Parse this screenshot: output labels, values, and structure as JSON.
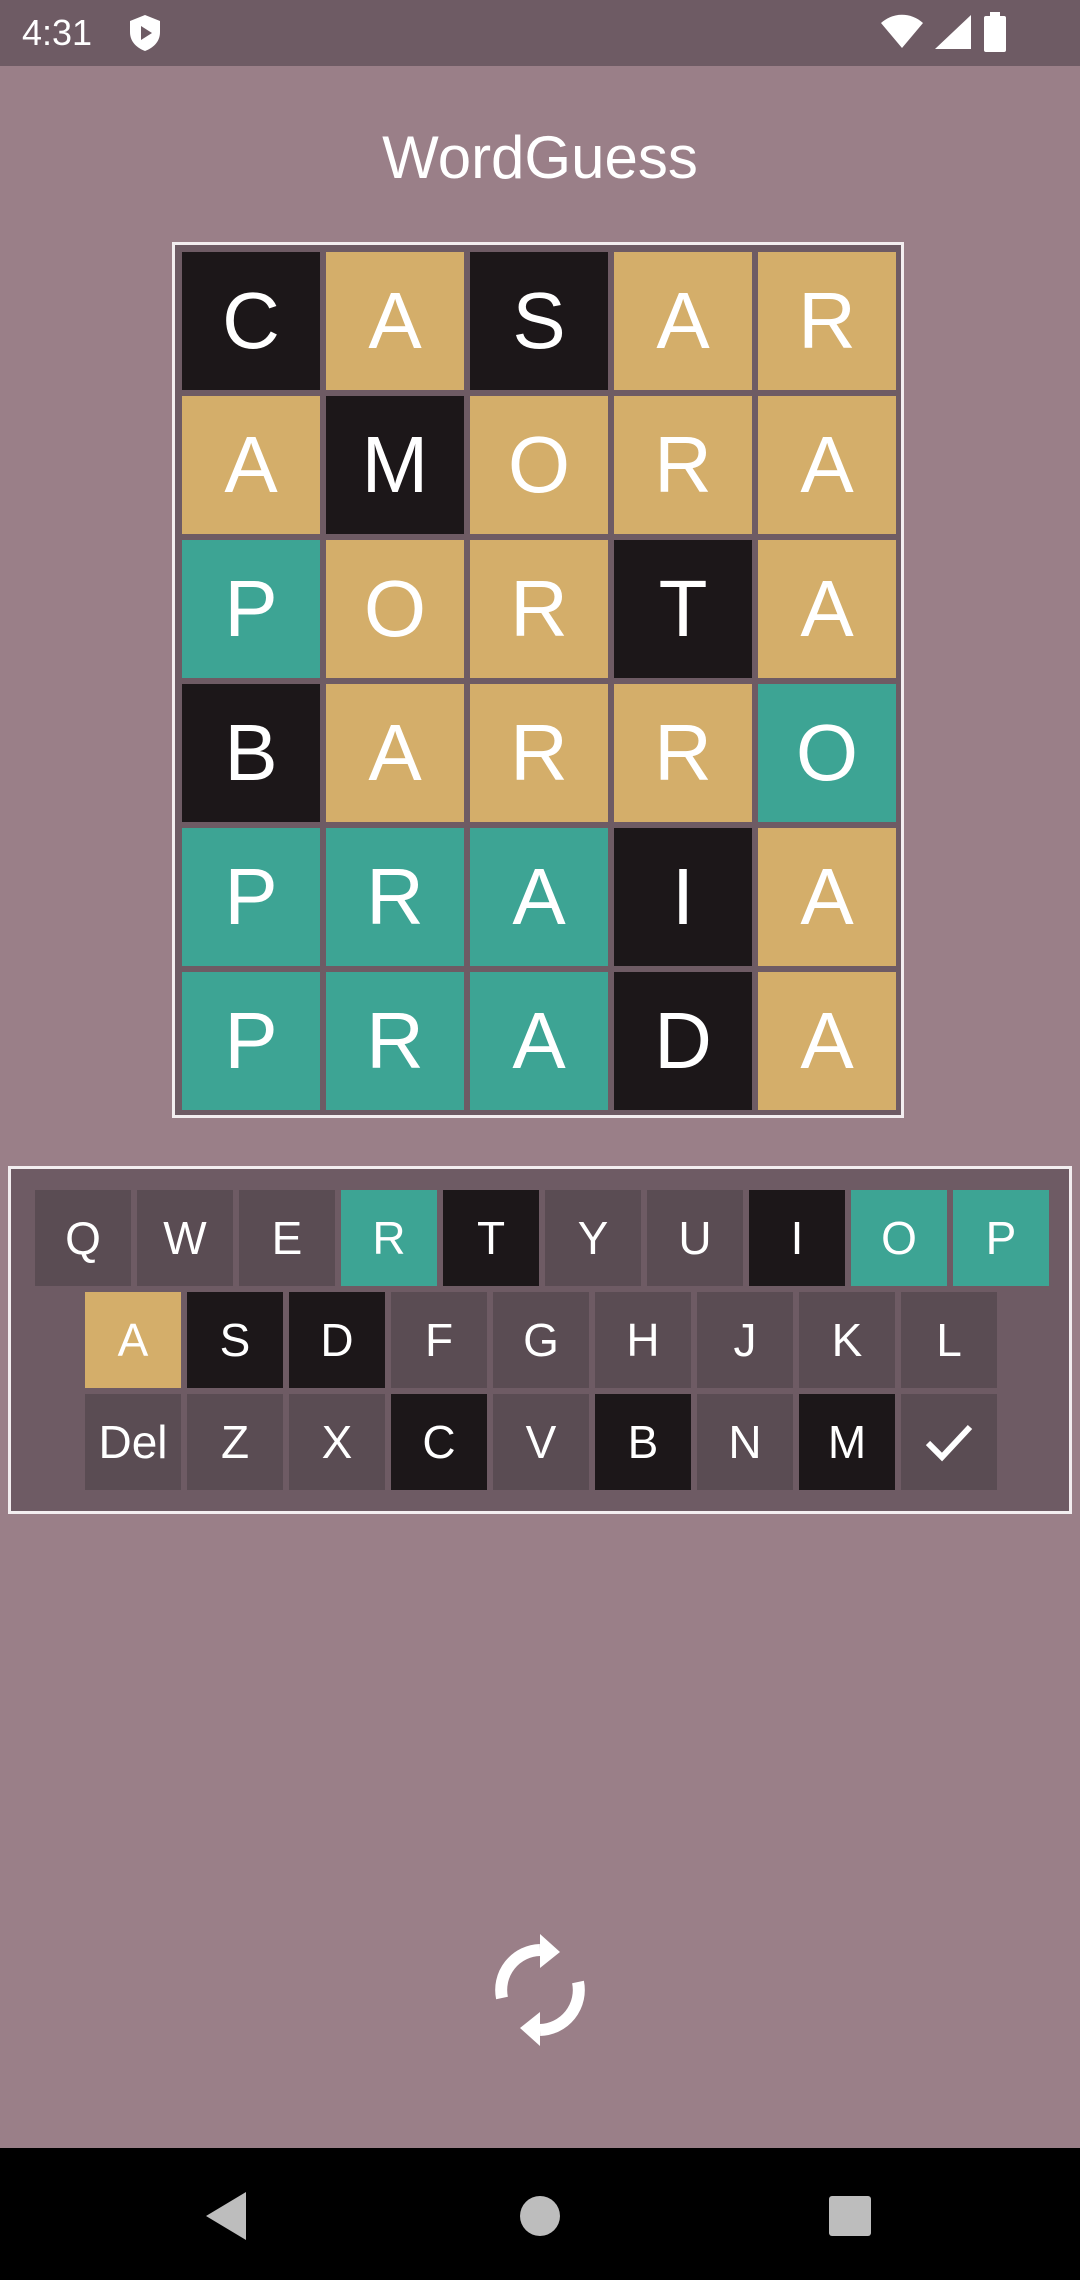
{
  "status_bar": {
    "time": "4:31"
  },
  "app": {
    "title": "WordGuess"
  },
  "colors": {
    "background": "#9a7f88",
    "panel": "#6e5b64",
    "absent": "#1c1719",
    "present": "#d4ae6a",
    "correct": "#3da494",
    "unused": "#5a4c53"
  },
  "board": {
    "rows": [
      {
        "letters": [
          "C",
          "A",
          "S",
          "A",
          "R"
        ],
        "states": [
          "absent",
          "present",
          "absent",
          "present",
          "present"
        ]
      },
      {
        "letters": [
          "A",
          "M",
          "O",
          "R",
          "A"
        ],
        "states": [
          "present",
          "absent",
          "present",
          "present",
          "present"
        ]
      },
      {
        "letters": [
          "P",
          "O",
          "R",
          "T",
          "A"
        ],
        "states": [
          "correct",
          "present",
          "present",
          "absent",
          "present"
        ]
      },
      {
        "letters": [
          "B",
          "A",
          "R",
          "R",
          "O"
        ],
        "states": [
          "absent",
          "present",
          "present",
          "present",
          "correct"
        ]
      },
      {
        "letters": [
          "P",
          "R",
          "A",
          "I",
          "A"
        ],
        "states": [
          "correct",
          "correct",
          "correct",
          "absent",
          "present"
        ]
      },
      {
        "letters": [
          "P",
          "R",
          "A",
          "D",
          "A"
        ],
        "states": [
          "correct",
          "correct",
          "correct",
          "absent",
          "present"
        ]
      }
    ]
  },
  "keyboard": {
    "rows": [
      [
        {
          "label": "Q",
          "state": "unused"
        },
        {
          "label": "W",
          "state": "unused"
        },
        {
          "label": "E",
          "state": "unused"
        },
        {
          "label": "R",
          "state": "correct"
        },
        {
          "label": "T",
          "state": "absent"
        },
        {
          "label": "Y",
          "state": "unused"
        },
        {
          "label": "U",
          "state": "unused"
        },
        {
          "label": "I",
          "state": "absent"
        },
        {
          "label": "O",
          "state": "correct"
        },
        {
          "label": "P",
          "state": "correct"
        }
      ],
      [
        {
          "label": "A",
          "state": "present"
        },
        {
          "label": "S",
          "state": "absent"
        },
        {
          "label": "D",
          "state": "absent"
        },
        {
          "label": "F",
          "state": "unused"
        },
        {
          "label": "G",
          "state": "unused"
        },
        {
          "label": "H",
          "state": "unused"
        },
        {
          "label": "J",
          "state": "unused"
        },
        {
          "label": "K",
          "state": "unused"
        },
        {
          "label": "L",
          "state": "unused"
        }
      ],
      [
        {
          "label": "Del",
          "state": "unused"
        },
        {
          "label": "Z",
          "state": "unused"
        },
        {
          "label": "X",
          "state": "unused"
        },
        {
          "label": "C",
          "state": "absent"
        },
        {
          "label": "V",
          "state": "unused"
        },
        {
          "label": "B",
          "state": "absent"
        },
        {
          "label": "N",
          "state": "unused"
        },
        {
          "label": "M",
          "state": "absent"
        },
        {
          "label": "",
          "icon": "check-icon",
          "state": "unused"
        }
      ]
    ]
  },
  "icons": {
    "status": [
      "shield-icon",
      "wifi-icon",
      "signal-icon",
      "battery-icon"
    ],
    "restart": "refresh-icon",
    "nav": [
      "back-icon",
      "home-icon",
      "recents-icon"
    ]
  }
}
